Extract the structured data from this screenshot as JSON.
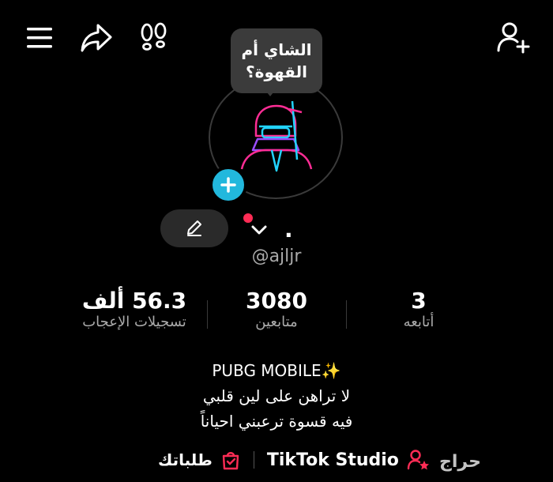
{
  "header": {
    "menu_icon": "hamburger-menu-icon",
    "share_icon": "share-arrow-icon",
    "footprints_icon": "footprints-icon",
    "add_friend_icon": "add-user-icon"
  },
  "profile": {
    "bubble_text": "الشاي أم القهوة؟",
    "avatar_alt": "avatar",
    "display_name": ".",
    "username": "@ajljr",
    "colors": {
      "plus": "#22b8dd",
      "notification_dot": "#fe2c55",
      "label": "#aaaaaa"
    }
  },
  "stats": [
    {
      "value": "56.3 ألف",
      "label": "تسجيلات الإعجاب"
    },
    {
      "value": "3080",
      "label": "متابعين"
    },
    {
      "value": "3",
      "label": "أتابعه"
    }
  ],
  "bio": {
    "line1": "PUBG MOBILE✨",
    "line2": "لا تراهن على لين قلبي",
    "line3": "فيه قسوة ترعبني احياناً"
  },
  "links": {
    "studio_label": "TikTok Studio",
    "orders_label": "طلباتك"
  },
  "watermark": "حراج"
}
